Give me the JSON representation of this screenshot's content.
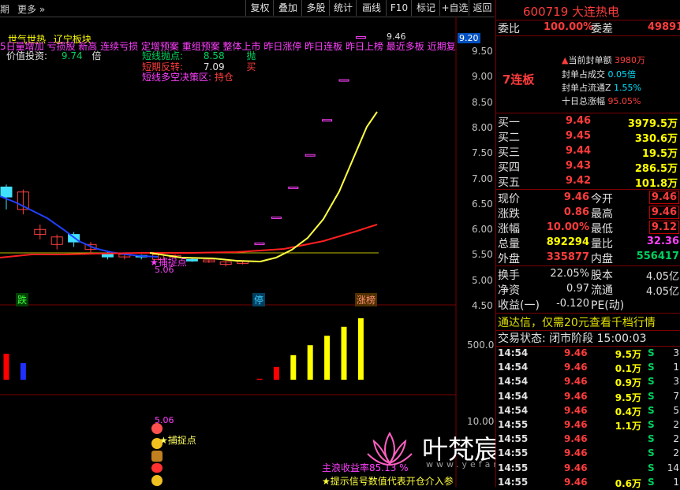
{
  "toolbar": {
    "left_cut": "期",
    "more": "更多",
    "more_arrow": "»",
    "buttons": [
      "复权",
      "叠加",
      "多股",
      "统计",
      "画线",
      "F10",
      "标记",
      "+自选",
      "返回"
    ]
  },
  "indicators": {
    "line1": [
      "世气世热",
      "辽宁板块"
    ],
    "line2": "5日量增加 亏损股 新高 连续亏损 定增预案 重组预案 整体上市 昨日涨停 昨日连板 昨日上榜 最近多板 近期复牌",
    "line3_label": "价值投资:",
    "line3_value": "9.74",
    "line3_unit": "倍",
    "short_point_label": "短线抛点:",
    "short_point_value": "8.58",
    "short_point_tag": "抛",
    "short_reverse_label": "短期反转:",
    "short_reverse_value": "7.09",
    "short_reverse_tag": "买",
    "decision_label": "短线多空决策区:",
    "decision_value": "持仓"
  },
  "price_axis": [
    "9.50",
    "9.00",
    "8.50",
    "8.00",
    "7.50",
    "7.00",
    "6.50",
    "6.00",
    "5.50",
    "5.00",
    "4.50"
  ],
  "price_tags": {
    "current": "9.20",
    "high_label": "9.46",
    "low_label": "5.06",
    "capture": "★捕捉点"
  },
  "markers": {
    "down": "跌",
    "stop": "停",
    "limit": "涨榜"
  },
  "volume_axis": "500.0",
  "sub_axis": "10.00",
  "sub_labels": {
    "value": "5.06",
    "capture": "★捕捉点",
    "profit": "主浪收益率85.13 %",
    "tip": "★提示信号数值代表开仓介入参"
  },
  "chart_data": {
    "type": "candlestick",
    "candles": [
      {
        "o": 6.45,
        "c": 6.25,
        "h": 6.5,
        "l": 6.0
      },
      {
        "o": 6.0,
        "c": 6.35,
        "h": 6.4,
        "l": 5.9
      },
      {
        "o": 5.5,
        "c": 5.6,
        "h": 5.7,
        "l": 5.4
      },
      {
        "o": 5.3,
        "c": 5.45,
        "h": 5.5,
        "l": 5.2
      },
      {
        "o": 5.5,
        "c": 5.35,
        "h": 5.55,
        "l": 5.25
      },
      {
        "o": 5.2,
        "c": 5.3,
        "h": 5.35,
        "l": 5.1
      },
      {
        "o": 5.1,
        "c": 5.05,
        "h": 5.15,
        "l": 5.0
      },
      {
        "o": 5.05,
        "c": 5.1,
        "h": 5.12,
        "l": 5.0
      },
      {
        "o": 5.08,
        "c": 5.05,
        "h": 5.1,
        "l": 5.0
      },
      {
        "o": 5.0,
        "c": 5.1,
        "h": 5.15,
        "l": 4.98
      },
      {
        "o": 5.05,
        "c": 5.08,
        "h": 5.1,
        "l": 5.02
      },
      {
        "o": 5.0,
        "c": 4.98,
        "h": 5.03,
        "l": 4.95
      },
      {
        "o": 4.95,
        "c": 4.99,
        "h": 5.0,
        "l": 4.93
      },
      {
        "o": 4.9,
        "c": 4.95,
        "h": 4.97,
        "l": 4.86
      },
      {
        "o": 4.92,
        "c": 4.96,
        "h": 4.98,
        "l": 4.9
      },
      {
        "o": 5.33,
        "c": 5.33,
        "h": 5.33,
        "l": 5.33
      },
      {
        "o": 5.85,
        "c": 5.85,
        "h": 5.85,
        "l": 5.85
      },
      {
        "o": 6.45,
        "c": 6.45,
        "h": 6.45,
        "l": 6.45
      },
      {
        "o": 7.1,
        "c": 7.1,
        "h": 7.1,
        "l": 7.1
      },
      {
        "o": 7.8,
        "c": 7.8,
        "h": 7.8,
        "l": 7.8
      },
      {
        "o": 8.6,
        "c": 8.6,
        "h": 8.6,
        "l": 8.6
      },
      {
        "o": 9.46,
        "c": 9.46,
        "h": 9.46,
        "l": 9.46
      }
    ],
    "volumes": [
      0.55,
      0.35,
      0,
      0,
      0,
      0,
      0,
      0,
      0,
      0,
      0,
      0,
      0,
      0,
      0,
      0.02,
      0.27,
      0.52,
      0.73,
      0.93,
      1.12,
      1.3
    ],
    "volume_colors": [
      "#ff0000",
      "#2030ff",
      "",
      "",
      "",
      "",
      "",
      "",
      "",
      "",
      "",
      "",
      "",
      "",
      "",
      "#ff0000",
      "#ff0000",
      "#ffff00",
      "#ffff00",
      "#ffff00",
      "#ffff00",
      "#ffff00"
    ]
  },
  "stock": {
    "code": "600719",
    "name": "大连热电",
    "wb_label": "委比",
    "wb_value": "100.00%",
    "wc_label": "委差",
    "wc_value": "49891",
    "streak": "7连板",
    "seal_amount_label": "当前封单额",
    "seal_amount_value": "3980万",
    "seal_vol_label": "封单占成交",
    "seal_vol_value": "0.05倍",
    "seal_float_label": "封单占流通Z",
    "seal_float_value": "1.55%",
    "ten_day_label": "十日总涨幅",
    "ten_day_value": "95.05%",
    "bids": [
      {
        "label": "买一",
        "price": "9.46",
        "vol": "3979.5万"
      },
      {
        "label": "买二",
        "price": "9.45",
        "vol": "330.6万"
      },
      {
        "label": "买三",
        "price": "9.44",
        "vol": "19.5万"
      },
      {
        "label": "买四",
        "price": "9.43",
        "vol": "286.5万"
      },
      {
        "label": "买五",
        "price": "9.42",
        "vol": "101.8万"
      }
    ],
    "quote": [
      {
        "l1": "现价",
        "v1": "9.46",
        "l2": "今开",
        "v2": "9.46"
      },
      {
        "l1": "涨跌",
        "v1": "0.86",
        "l2": "最高",
        "v2": "9.46"
      },
      {
        "l1": "涨幅",
        "v1": "10.00%",
        "l2": "最低",
        "v2": "9.12"
      },
      {
        "l1": "总量",
        "v1": "892294",
        "l2": "量比",
        "v2": "32.36"
      },
      {
        "l1": "外盘",
        "v1": "335877",
        "l2": "内盘",
        "v2": "556417"
      }
    ],
    "fin": [
      {
        "l1": "换手",
        "v1": "22.05%",
        "l2": "股本",
        "v2": "4.05亿"
      },
      {
        "l1": "净资",
        "v1": "0.97",
        "l2": "流通",
        "v2": "4.05亿"
      },
      {
        "l1": "收益(一)",
        "v1": "-0.120",
        "l2": "PE(动)",
        "v2": ""
      }
    ],
    "promo": "通达信，仅需20元查看千档行情",
    "status_label": "交易状态: 闭市阶段",
    "status_time": "15:00:03",
    "ticks": [
      {
        "t": "14:54",
        "p": "9.46",
        "v": "9.5万",
        "s": "S",
        "n": "3"
      },
      {
        "t": "14:54",
        "p": "9.46",
        "v": "0.1万",
        "s": "S",
        "n": "1"
      },
      {
        "t": "14:54",
        "p": "9.46",
        "v": "0.9万",
        "s": "S",
        "n": "3"
      },
      {
        "t": "14:54",
        "p": "9.46",
        "v": "9.5万",
        "s": "S",
        "n": "7"
      },
      {
        "t": "14:54",
        "p": "9.46",
        "v": "0.4万",
        "s": "S",
        "n": "5"
      },
      {
        "t": "14:55",
        "p": "9.46",
        "v": "1.1万",
        "s": "S",
        "n": "2"
      },
      {
        "t": "14:55",
        "p": "9.46",
        "v": "",
        "s": "S",
        "n": "2"
      },
      {
        "t": "14:55",
        "p": "9.46",
        "v": "",
        "s": "S",
        "n": "2"
      },
      {
        "t": "14:55",
        "p": "9.46",
        "v": "",
        "s": "S",
        "n": "14"
      },
      {
        "t": "14:55",
        "p": "9.46",
        "v": "0.6万",
        "s": "S",
        "n": "1"
      }
    ]
  },
  "watermark": {
    "brand": "叶梵宸指标公式网",
    "url": "www.yefanchen.com"
  }
}
